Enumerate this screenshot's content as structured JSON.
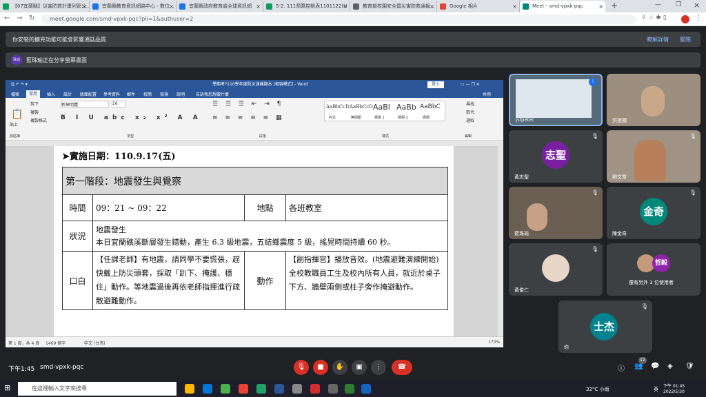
{
  "tabs": [
    {
      "label": "【07宜蘭縣】災害防救計畫列管公...",
      "color": "#0f9d58"
    },
    {
      "label": "宜蘭縣教育資訊網路中心 - 數位...",
      "color": "#1a73e8"
    },
    {
      "label": "宜蘭縣政府教育處全球資訊網",
      "color": "#1a73e8"
    },
    {
      "label": "5-2. 111預算控帳表1101122(t)",
      "color": "#0f9d58"
    },
    {
      "label": "教育部校園安全暨災害防救通報...",
      "color": "#5f6368"
    },
    {
      "label": "Google 相片",
      "color": "#ea4335"
    },
    {
      "label": "Meet - smd-vpxk-pqc",
      "color": "#00897b"
    }
  ],
  "url": "meet.google.com/smd-vpxk-pqc?pli=1&authuser=2",
  "banner1": {
    "text": "你安裝的擴充功能可能會影響通話品質",
    "link1": "瞭解詳情",
    "link2": "關閉"
  },
  "banner2": {
    "avatar": "珠瑜",
    "text": "藍珠瑜正在分享螢幕畫面"
  },
  "word": {
    "title": "學期考?110學年度防災演練腳本 [相容模式] - Word",
    "login": "登入",
    "tabs": [
      "檔案",
      "常用",
      "插入",
      "設計",
      "版面配置",
      "參考資料",
      "郵件",
      "校閱",
      "檢視",
      "說明",
      "告訴我您想做什麼"
    ],
    "share": "共用",
    "font": "新細明體",
    "size": "16",
    "styles": [
      "AaBbCcD",
      "AaBbCcD",
      "AaBl",
      "AaBb",
      "AaBbC"
    ],
    "style_names": [
      "內文",
      "無間距",
      "標題 1",
      "標題 2",
      "標題"
    ],
    "groups": [
      "剪貼簿",
      "字型",
      "段落",
      "樣式",
      "編輯"
    ],
    "edit": [
      "尋找",
      "取代",
      "選取"
    ],
    "clip": [
      "貼上",
      "剪下",
      "複製",
      "複製格式"
    ],
    "status_left": "第 1 頁，共 4 頁",
    "status_words": "1469 個字",
    "status_lang": "中文 (台灣)",
    "zoom": "170%"
  },
  "doc": {
    "date_line": "➤實施日期：110.9.17(五)",
    "stage": "第一階段：地震發生與覺察",
    "time_label": "時間",
    "time_value": "09：21 ~ 09：22",
    "place_label": "地點",
    "place_value": "各班教室",
    "status_label": "狀況",
    "status_1": "地震發生",
    "status_2": "本日宜蘭礁溪斷層發生錯動，產生 6.3 級地震，五結鄉震度 5 級，搖晃時間持續 60 秒。",
    "speech_label": "口白",
    "speech": "【任課老師】有地震，請同學不要慌張，趕快戴上防災頭套，採取「趴下、掩護、穩住」動作。等地震過後再依老師指揮進行疏散避難動作。",
    "action_label": "動作",
    "action_1": "【副指揮官】播放音效。(地震避難演練開始)",
    "action_2": "全校教職員工生及校內所有人員，就近於桌子下方、牆壁兩側或柱子旁作掩避動作。"
  },
  "participants": [
    {
      "name": "jsfpeter"
    },
    {
      "name": "洪祖賜"
    },
    {
      "name": "黃志聖",
      "initials": "志聖",
      "color": "#7b1fa2"
    },
    {
      "name": "劉文章"
    },
    {
      "name": "藍珠瑜"
    },
    {
      "name": "陳金奇",
      "initials": "金奇",
      "color": "#00897b"
    },
    {
      "name": "黃俊仁"
    },
    {
      "name": "還有另外 3 位使用者",
      "initials": "哲毅",
      "color": "#8e24aa"
    },
    {
      "name": "你",
      "initials": "士杰",
      "color": "#00838f"
    }
  ],
  "meeting": {
    "time": "下午1:45",
    "code": "smd-vpxk-pqc",
    "badge": "12"
  },
  "taskbar": {
    "search": "在這裡輸入文字來搜尋",
    "weather": "32°C 小雨",
    "time": "下午 01:45",
    "date": "2022/5/30",
    "ime": "英"
  }
}
